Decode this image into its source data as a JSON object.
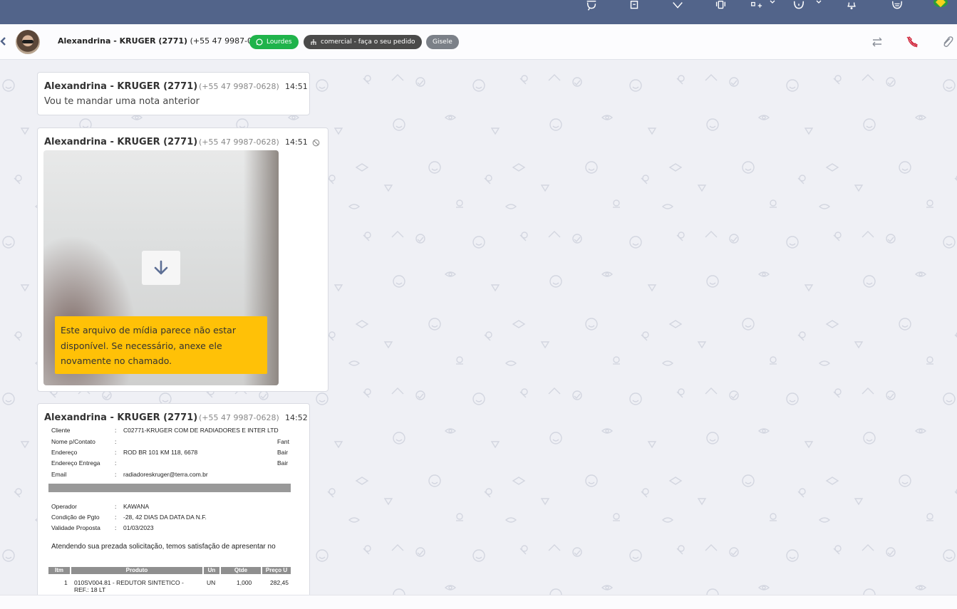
{
  "header": {
    "contact_name": "Alexandrina - KRUGER (2771)",
    "contact_phone": "(+55 47 9987-0628)",
    "badges": [
      {
        "label": "Lourdes",
        "color": "#1fb34b"
      },
      {
        "label": "comercial - faça o seu pedido",
        "color": "#4a4a4a"
      },
      {
        "label": "Gisele",
        "color": "#7b8088"
      }
    ]
  },
  "messages": [
    {
      "sender": "Alexandrina - KRUGER (2771)",
      "phone": "(+55 47 9987-0628)",
      "time": "14:51",
      "text": "Vou te mandar uma nota anterior"
    },
    {
      "sender": "Alexandrina - KRUGER (2771)",
      "phone": "(+55 47 9987-0628)",
      "time": "14:51",
      "warning_lines": [
        "Este arquivo de mídia parece não estar",
        "disponível. Se necessário, anexe ele",
        "novamente no chamado."
      ]
    },
    {
      "sender": "Alexandrina - KRUGER (2771)",
      "phone": "(+55 47 9987-0628)",
      "time": "14:52",
      "document": {
        "fields": [
          {
            "label": "Cliente",
            "value": "C02771-KRUGER COM DE RADIADORES E INTER LTD",
            "right": ""
          },
          {
            "label": "Nome p/Contato",
            "value": "",
            "right": "Fant"
          },
          {
            "label": "Endereço",
            "value": "ROD BR 101 KM 118, 6678",
            "right": "Bair"
          },
          {
            "label": "Endereço Entrega",
            "value": "",
            "right": "Bair"
          },
          {
            "label": "Email",
            "value": "radiadoreskruger@terra.com.br",
            "right": ""
          }
        ],
        "fields2": [
          {
            "label": "Operador",
            "value": "KAWANA"
          },
          {
            "label": "Condição de Pgto",
            "value": "-28, 42 DIAS DA DATA DA N.F."
          },
          {
            "label": "Validade Proposta",
            "value": "01/03/2023"
          }
        ],
        "colon": ":",
        "paragraph": "Atendendo sua prezada solicitação, temos satisfação de apresentar no",
        "table_headers": [
          "Itm",
          "Produto",
          "Un",
          "Qtde",
          "Preço U"
        ],
        "row": {
          "item": "1",
          "product_line1": "010SV004.81 - REDUTOR SINTETICO -",
          "product_line2": "REF.: 18 LT",
          "unit": "UN",
          "qty": "1,000",
          "price": "282,45"
        }
      }
    }
  ]
}
